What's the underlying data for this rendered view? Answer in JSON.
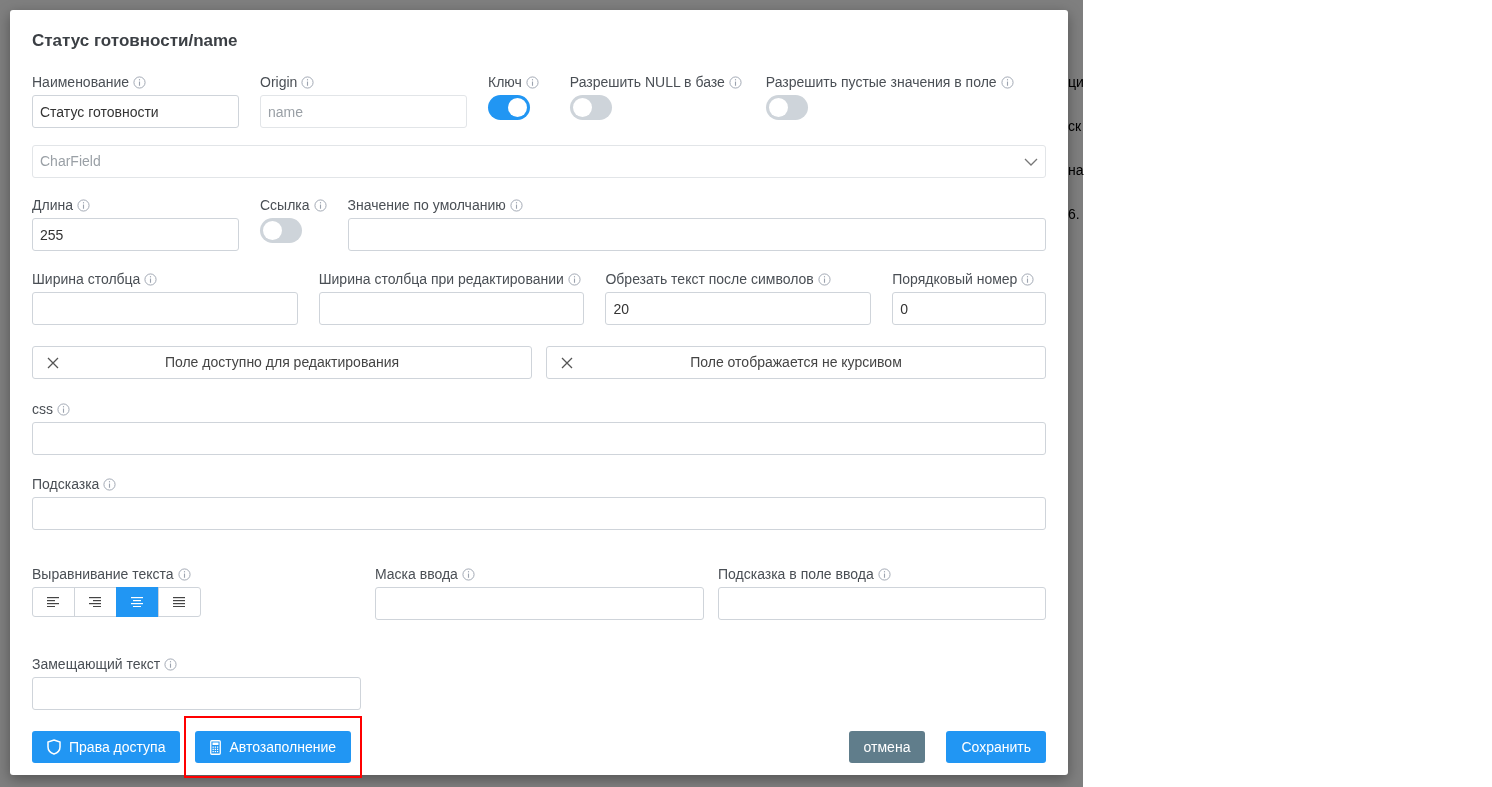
{
  "background_fragments": [
    "ци",
    "ск",
    "на",
    "6."
  ],
  "dialog": {
    "title": "Статус готовности/name",
    "row1": {
      "fields": [
        {
          "label": "Наименование",
          "value": "Статус готовности"
        },
        {
          "label": "Origin",
          "placeholder": "name"
        }
      ],
      "toggles": [
        {
          "label": "Ключ",
          "on": true
        },
        {
          "label": "Разрешить NULL в базе",
          "on": false
        },
        {
          "label": "Разрешить пустые значения в поле",
          "on": false
        }
      ]
    },
    "type_select": {
      "placeholder": "CharField"
    },
    "row3": {
      "length": {
        "label": "Длина",
        "value": "255"
      },
      "link_toggle": {
        "label": "Ссылка",
        "on": false
      },
      "default": {
        "label": "Значение по умолчанию"
      }
    },
    "row4": [
      {
        "label": "Ширина столбца"
      },
      {
        "label": "Ширина столбца при редактировании"
      },
      {
        "label": "Обрезать текст после символов",
        "value": "20"
      },
      {
        "label": "Порядковый номер",
        "value": "0"
      }
    ],
    "flag_buttons": [
      {
        "label": "Поле доступно для редактирования",
        "checked": false
      },
      {
        "label": "Поле отображается не курсивом",
        "checked": false
      }
    ],
    "css": {
      "label": "css"
    },
    "hint": {
      "label": "Подсказка"
    },
    "alignment": {
      "label": "Выравнивание текста",
      "options": [
        {
          "kind": "left",
          "selected": false
        },
        {
          "kind": "right",
          "selected": false
        },
        {
          "kind": "center",
          "selected": true
        },
        {
          "kind": "justify",
          "selected": false
        }
      ]
    },
    "mask": {
      "label": "Маска ввода"
    },
    "input_hint": {
      "label": "Подсказка в поле ввода"
    },
    "alt_text": {
      "label": "Замещающий текст"
    },
    "buttons_left": [
      {
        "kind": "shield",
        "label": "Права доступа",
        "highlighted": false
      },
      {
        "kind": "calculator",
        "label": "Автозаполнение",
        "highlighted": true
      }
    ],
    "buttons_right": [
      {
        "kind": "cancel",
        "label": "отмена"
      },
      {
        "kind": "save",
        "label": "Сохранить"
      }
    ]
  }
}
